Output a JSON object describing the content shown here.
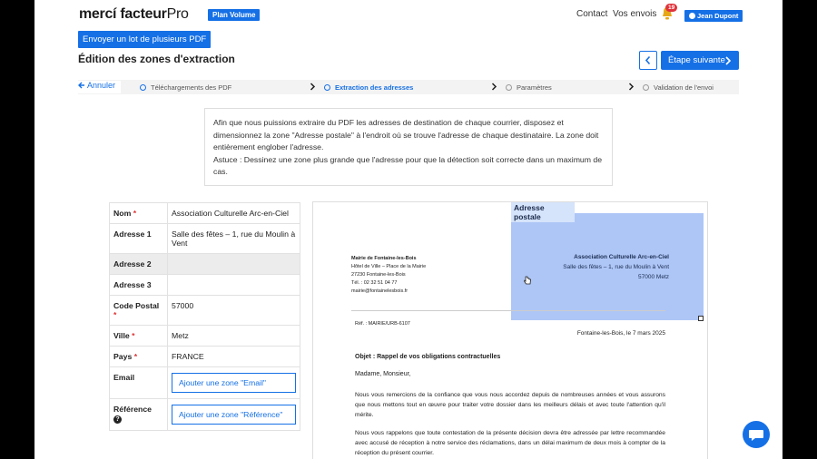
{
  "header": {
    "logo_main": "mercí facteur",
    "logo_pro": "Pro",
    "plan_badge": "Plan Volume",
    "contact": "Contact",
    "my_sends": "Vos envois",
    "notifications": "19",
    "user": "Jean Dupont"
  },
  "toolbar": {
    "send_lot": "Envoyer un lot de plusieurs PDF",
    "title": "Édition des zones d'extraction",
    "next": "Étape suivante"
  },
  "steps": {
    "cancel": "Annuler",
    "items": [
      {
        "label": "Téléchargements des PDF",
        "state": "done"
      },
      {
        "label": "Extraction des adresses",
        "state": "active"
      },
      {
        "label": "Paramètres",
        "state": "todo"
      },
      {
        "label": "Validation de l'envoi",
        "state": "todo"
      }
    ]
  },
  "instructions": {
    "line1": "Afin que nous puissions extraire du PDF les adresses de destination de chaque courrier, disposez et dimensionnez la zone \"Adresse postale\" à l'endroit où se trouve l'adresse de chaque destinataire. La zone doit entièrement englober l'adresse.",
    "line2": "Astuce : Dessinez une zone plus grande que l'adresse pour que la détection soit correcte dans un maximum de cas."
  },
  "fields": [
    {
      "label": "Nom",
      "required": true,
      "value": "Association Culturelle Arc-en-Ciel"
    },
    {
      "label": "Adresse 1",
      "required": false,
      "value": "Salle des fêtes – 1, rue du Moulin à Vent"
    },
    {
      "label": "Adresse 2",
      "required": false,
      "value": ""
    },
    {
      "label": "Adresse 3",
      "required": false,
      "value": ""
    },
    {
      "label": "Code Postal",
      "required": true,
      "value": "57000"
    },
    {
      "label": "Ville",
      "required": true,
      "value": "Metz"
    },
    {
      "label": "Pays",
      "required": true,
      "value": "FRANCE"
    },
    {
      "label": "Email",
      "required": false,
      "button": "Ajouter une zone \"Email\""
    },
    {
      "label": "Référence",
      "required": false,
      "button": "Ajouter une zone \"Référence\""
    }
  ],
  "preview": {
    "zone_label": "Adresse postale",
    "sender": [
      "Mairie de Fontaine-les-Bois",
      "Hôtel de Ville – Place de la Mairie",
      "27230 Fontaine-les-Bois",
      "Tél. : 02 32 51 04 77",
      "mairie@fontainelesbois.fr"
    ],
    "recipient": [
      "Association Culturelle Arc-en-Ciel",
      "Salle des fêtes – 1, rue du Moulin à Vent",
      "57000 Metz"
    ],
    "ref": "Réf. : MAIRIE/URB-6107",
    "date": "Fontaine-les-Bois, le 7 mars 2025",
    "subject": "Objet : Rappel de vos obligations contractuelles",
    "greeting": "Madame, Monsieur,",
    "para1": "Nous vous remercions de la confiance que vous nous accordez depuis de nombreuses années et vous assurons que nous mettons tout en œuvre pour traiter votre dossier dans les meilleurs délais et avec toute l'attention qu'il mérite.",
    "para2": "Nous vous rappelons que toute contestation de la présente décision devra être adressée par lettre recommandée avec accusé de réception à notre service des réclamations, dans un délai maximum de deux mois à compter de la réception du présent courrier."
  },
  "colors": {
    "accent": "#1570e6",
    "zone": "#7aa0f0"
  }
}
